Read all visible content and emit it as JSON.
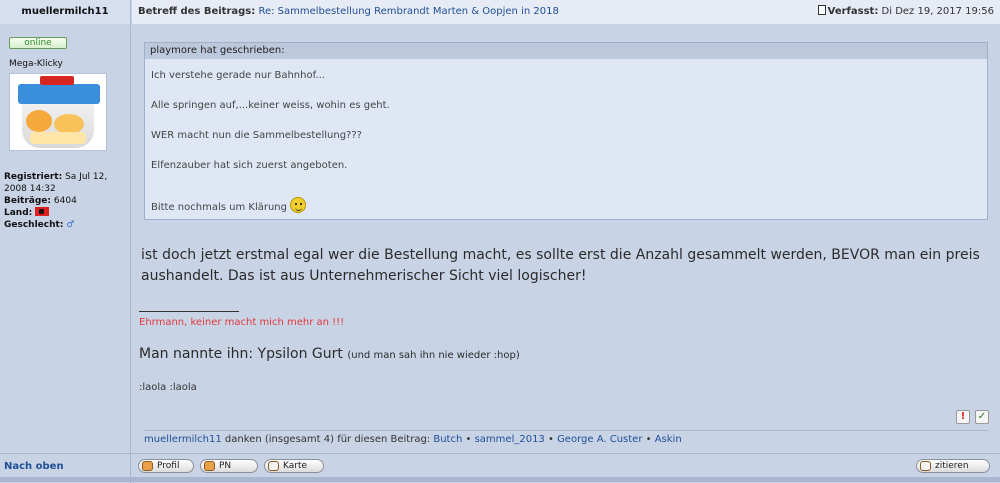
{
  "post": {
    "author": "muellermilch11",
    "subject_label": "Betreff des Beitrags:",
    "subject": "Re: Sammelbestellung Rembrandt Marten & Oopjen in 2018",
    "posted_label": "Verfasst:",
    "posted_date": "Di Dez 19, 2017 19:56"
  },
  "user": {
    "online": "online",
    "rank": "Mega-Klicky",
    "registered_label": "Registriert:",
    "registered_value": "Sa Jul 12, 2008 14:32",
    "posts_label": "Beiträge:",
    "posts_value": "6404",
    "country_label": "Land:",
    "gender_label": "Geschlecht:",
    "gender_symbol": "♂"
  },
  "quote": {
    "header": "playmore hat geschrieben:",
    "lines": [
      "Ich verstehe gerade nur Bahnhof...",
      "Alle springen auf,...keiner weiss, wohin es geht.",
      "WER macht nun die Sammelbestellung???",
      "Elfenzauber hat sich zuerst angeboten.",
      "Bitte nochmals um Klärung"
    ]
  },
  "body": {
    "text": "ist doch jetzt erstmal egal wer die Bestellung macht, es sollte erst die Anzahl gesammelt werden, BEVOR man ein preis aushandelt. Das ist aus Unternehmerischer Sicht viel logischer!"
  },
  "signature": {
    "line1": "Ehrmann, keiner macht mich mehr an !!!",
    "line2_big": "Man nannte ihn: Ypsilon Gurt",
    "line2_small": "(und man sah ihn nie wieder :hop)",
    "line3": ":laola :laola"
  },
  "thanks": {
    "prefix_user": "muellermilch11",
    "text": "danken (insgesamt 4) für diesen Beitrag:",
    "users": [
      "Butch",
      "sammel_2013",
      "George A. Custer",
      "Askin"
    ]
  },
  "bottom": {
    "back_to_top": "Nach oben",
    "profile": "Profil",
    "pm": "PN",
    "map": "Karte",
    "quote": "zitieren"
  },
  "icons": {
    "report": "!",
    "like": "✓"
  }
}
